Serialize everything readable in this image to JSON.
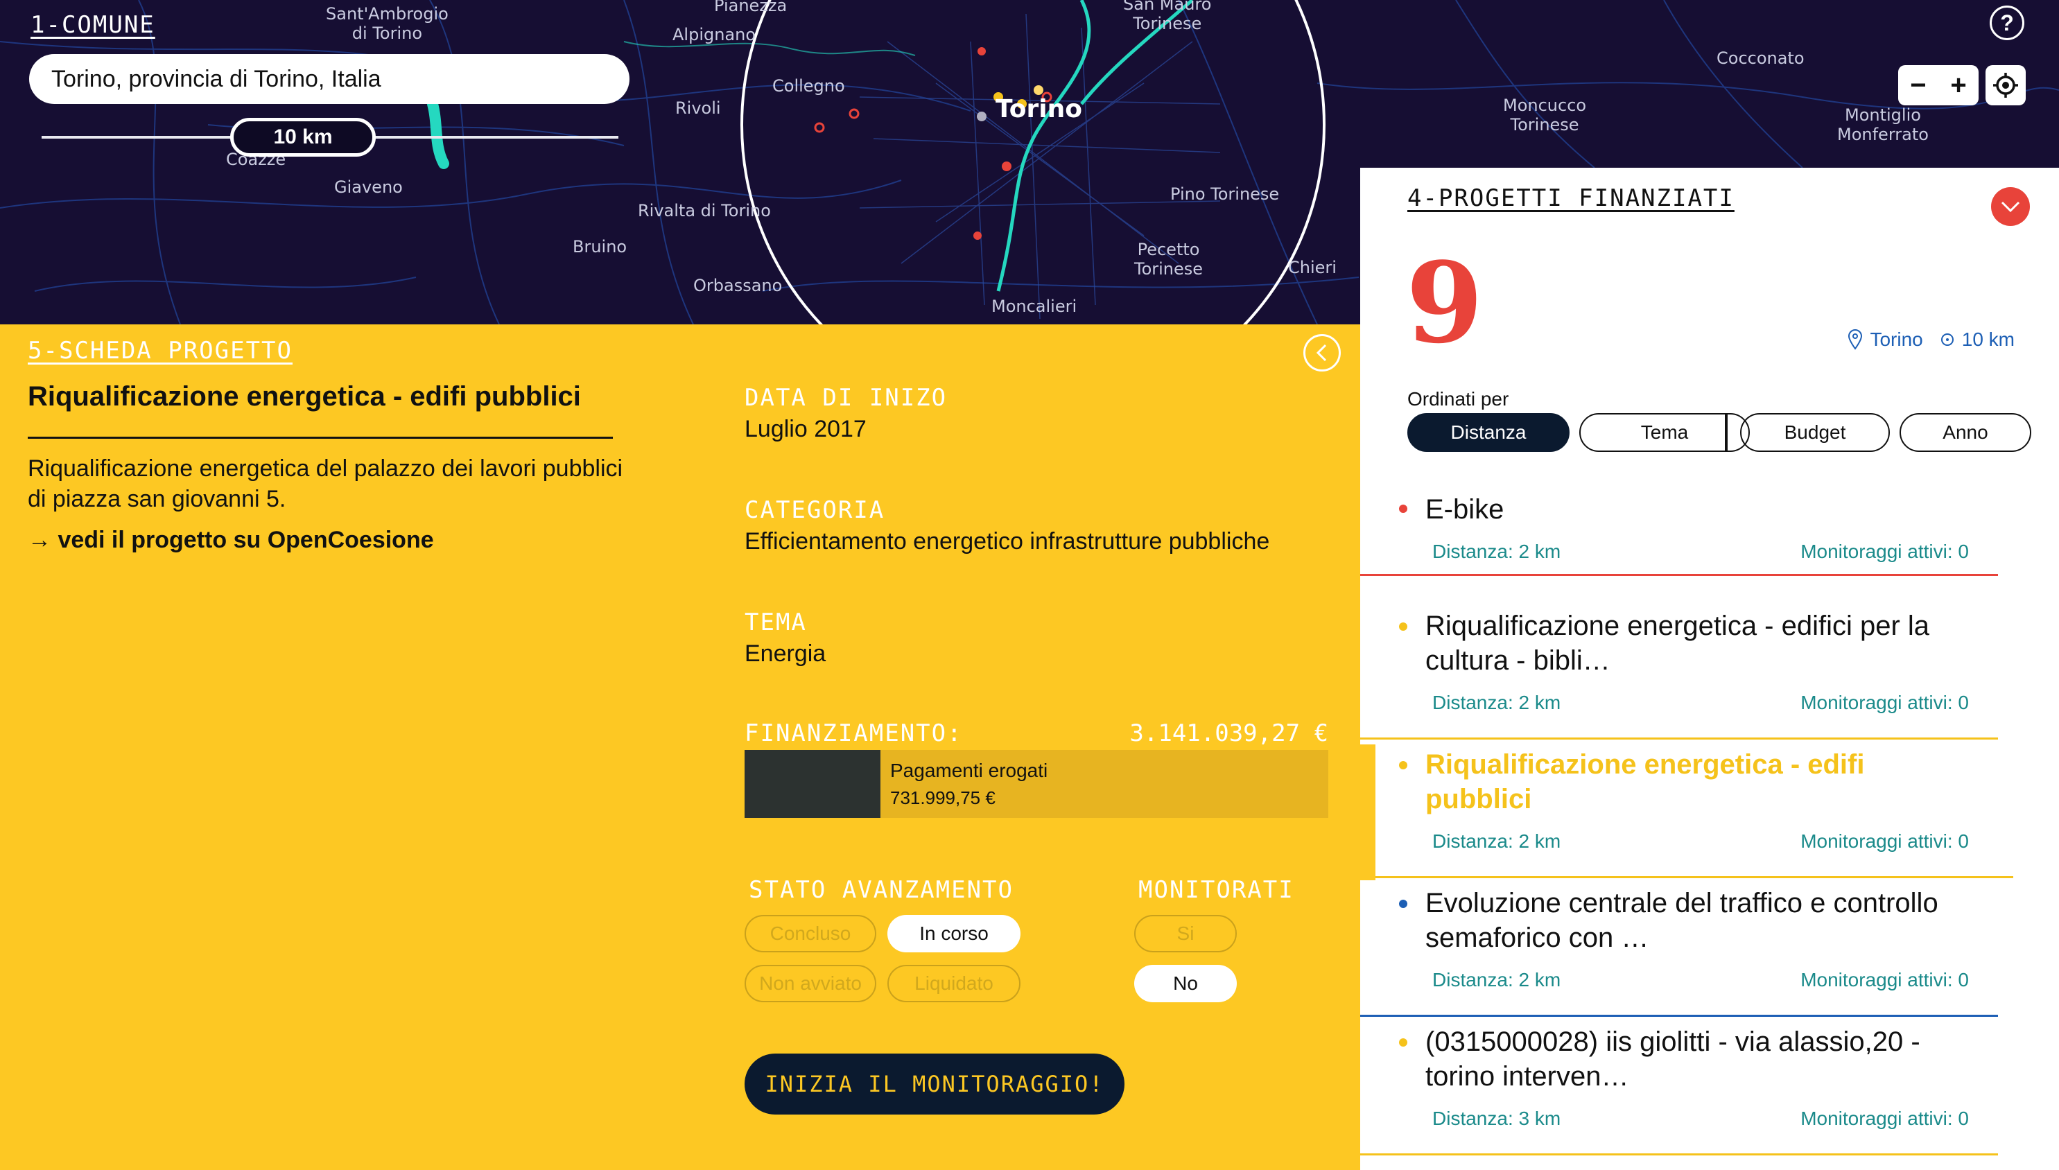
{
  "map": {
    "section_title": "1-COMUNE",
    "search_value": "Torino, provincia di Torino, Italia",
    "radius_label": "10 km",
    "help_glyph": "?",
    "zoom_out": "−",
    "zoom_in": "+",
    "labels": {
      "sant_ambrogio": "Sant'Ambrogio\ndi Torino",
      "pianezza": "Pianezza",
      "alpignano": "Alpignano",
      "collegno": "Collegno",
      "rivoli": "Rivoli",
      "san_mauro": "San Mauro\nTorinese",
      "torino": "Torino",
      "coazze": "Coazze",
      "giaveno": "Giaveno",
      "rivalta": "Rivalta di Torino",
      "bruino": "Bruino",
      "orbassano": "Orbassano",
      "moncalieri": "Moncalieri",
      "pino": "Pino Torinese",
      "pecetto": "Pecetto\nTorinese",
      "chieri": "Chieri",
      "cocconato": "Cocconato",
      "moncucco": "Moncucco\nTorinese",
      "montiglio": "Montiglio\nMonferrato"
    }
  },
  "detail": {
    "section_title": "5-SCHEDA PROGETTO",
    "title": "Riqualificazione energetica - edifi pubblici",
    "description": "Riqualificazione energetica del palazzo dei lavori pubblici di piazza san giovanni 5.",
    "link": "→ vedi il progetto su OpenCoesione",
    "data_label": "DATA DI INIZO",
    "data_value": "Luglio 2017",
    "categoria_label": "CATEGORIA",
    "categoria_value": "Efficientamento energetico infrastrutture pubbliche",
    "tema_label": "TEMA",
    "tema_value": "Energia",
    "finanziamento_label": "FINANZIAMENTO:",
    "finanziamento_total": "3.141.039,27 €",
    "pagamenti_label": "Pagamenti erogati",
    "pagamenti_amount": "731.999,75 €",
    "paid_fraction": 0.233,
    "stato_label": "STATO AVANZAMENTO",
    "stato_options": {
      "concluso": "Concluso",
      "in_corso": "In corso",
      "non_avviato": "Non avviato",
      "liquidato": "Liquidato"
    },
    "stato_selected": "In corso",
    "monitorati_label": "MONITORATI",
    "monitorati_options": {
      "si": "Si",
      "no": "No"
    },
    "monitorati_selected": "No",
    "cta": "INIZIA IL MONITORAGGIO!"
  },
  "projects": {
    "section_title": "4-PROGETTI FINANZIATI",
    "count": "9",
    "location": "Torino",
    "radius": "10 km",
    "sort_label": "Ordinati per",
    "sort_options": [
      "Distanza",
      "Tema",
      "Budget",
      "Anno"
    ],
    "sort_active": "Distanza",
    "items": [
      {
        "name": "E-bike",
        "distance": "Distanza: 2 km",
        "monitoring": "Monitoraggi attivi: 0",
        "color": "#e8433a"
      },
      {
        "name": "Riqualificazione energetica - edifici per la cultura - bibli…",
        "distance": "Distanza: 2 km",
        "monitoring": "Monitoraggi attivi: 0",
        "color": "#f5c21b"
      },
      {
        "name": "Riqualificazione energetica - edifi pubblici",
        "distance": "Distanza: 2 km",
        "monitoring": "Monitoraggi attivi: 0",
        "color": "#f5c21b"
      },
      {
        "name": "Evoluzione centrale del traffico e controllo semaforico con …",
        "distance": "Distanza: 2 km",
        "monitoring": "Monitoraggi attivi: 0",
        "color": "#1d5fb5"
      },
      {
        "name": "(0315000028) iis giolitti - via alassio,20 - torino interven…",
        "distance": "Distanza: 3 km",
        "monitoring": "Monitoraggi attivi: 0",
        "color": "#f5c21b"
      }
    ],
    "selected_color": "#f5c21b"
  }
}
